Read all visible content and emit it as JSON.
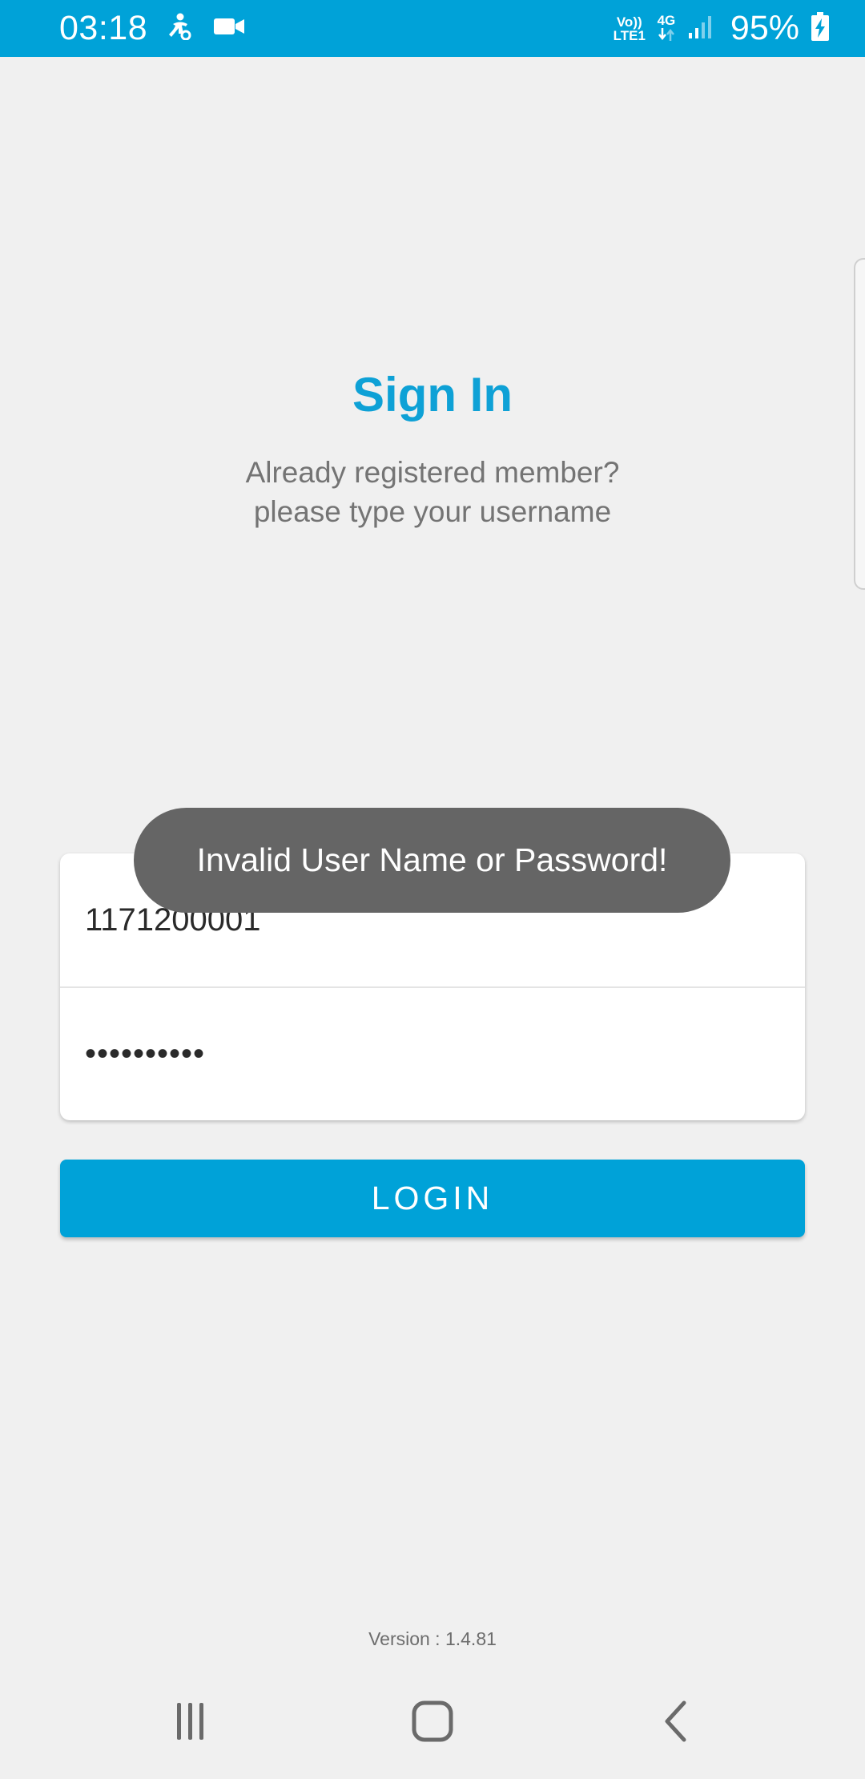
{
  "status_bar": {
    "time": "03:18",
    "volte_label_top": "Vo))",
    "volte_label_bottom": "LTE1",
    "network_label": "4G",
    "battery_percent": "95%",
    "icons": [
      "accessibility-icon",
      "video-camera-icon",
      "data-arrows-icon",
      "signal-icon",
      "battery-charging-icon"
    ]
  },
  "header": {
    "title": "Sign In",
    "subtitle_line1": "Already registered member?",
    "subtitle_line2": "please type your username"
  },
  "form": {
    "username_value": "1171200001",
    "password_masked": "••••••••••"
  },
  "login_button": {
    "label": "LOGIN"
  },
  "toast": {
    "message": "Invalid User Name or Password!"
  },
  "footer": {
    "version": "Version : 1.4.81"
  },
  "nav_bar": {
    "icons": [
      "recent-apps-icon",
      "home-icon",
      "back-icon"
    ]
  },
  "colors": {
    "accent": "#00a2d8",
    "title": "#0ea1d6",
    "background": "#f0f0f0",
    "toast_bg": "#656565"
  }
}
